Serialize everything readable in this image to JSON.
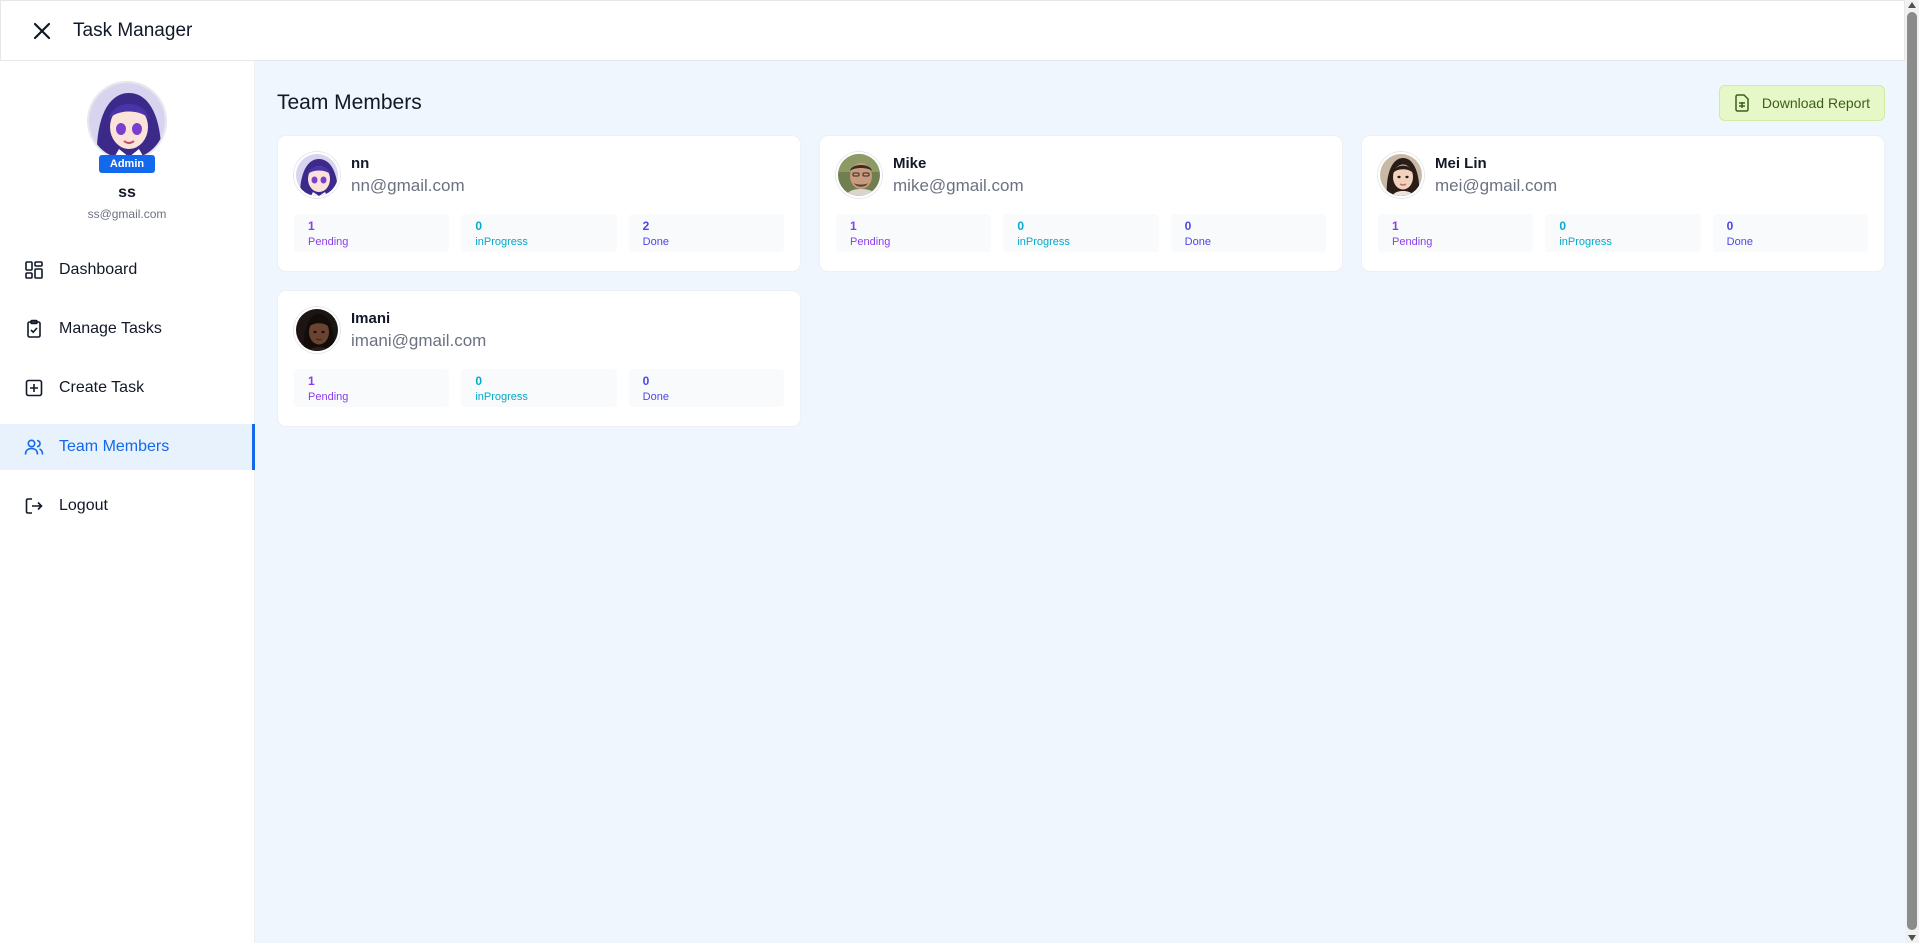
{
  "app": {
    "title": "Task Manager"
  },
  "profile": {
    "role": "Admin",
    "name": "ss",
    "email": "ss@gmail.com"
  },
  "nav": [
    {
      "label": "Dashboard",
      "icon": "dashboard-icon",
      "active": false
    },
    {
      "label": "Manage Tasks",
      "icon": "clipboard-check-icon",
      "active": false
    },
    {
      "label": "Create Task",
      "icon": "plus-square-icon",
      "active": false
    },
    {
      "label": "Team Members",
      "icon": "users-icon",
      "active": true
    },
    {
      "label": "Logout",
      "icon": "logout-icon",
      "active": false
    }
  ],
  "page": {
    "title": "Team Members",
    "download_label": "Download Report"
  },
  "members": [
    {
      "name": "nn",
      "email": "nn@gmail.com",
      "pending": "1",
      "inprogress": "0",
      "done": "2"
    },
    {
      "name": "Mike",
      "email": "mike@gmail.com",
      "pending": "1",
      "inprogress": "0",
      "done": "0"
    },
    {
      "name": "Mei Lin",
      "email": "mei@gmail.com",
      "pending": "1",
      "inprogress": "0",
      "done": "0"
    },
    {
      "name": "Imani",
      "email": "imani@gmail.com",
      "pending": "1",
      "inprogress": "0",
      "done": "0"
    }
  ],
  "labels": {
    "pending": "Pending",
    "inprogress": "inProgress",
    "done": "Done"
  },
  "colors": {
    "accent": "#1368ec",
    "pending": "#8b3dee",
    "inprogress": "#06a9c9",
    "done": "#4f46e5",
    "download_bg": "#e6f8c8"
  }
}
